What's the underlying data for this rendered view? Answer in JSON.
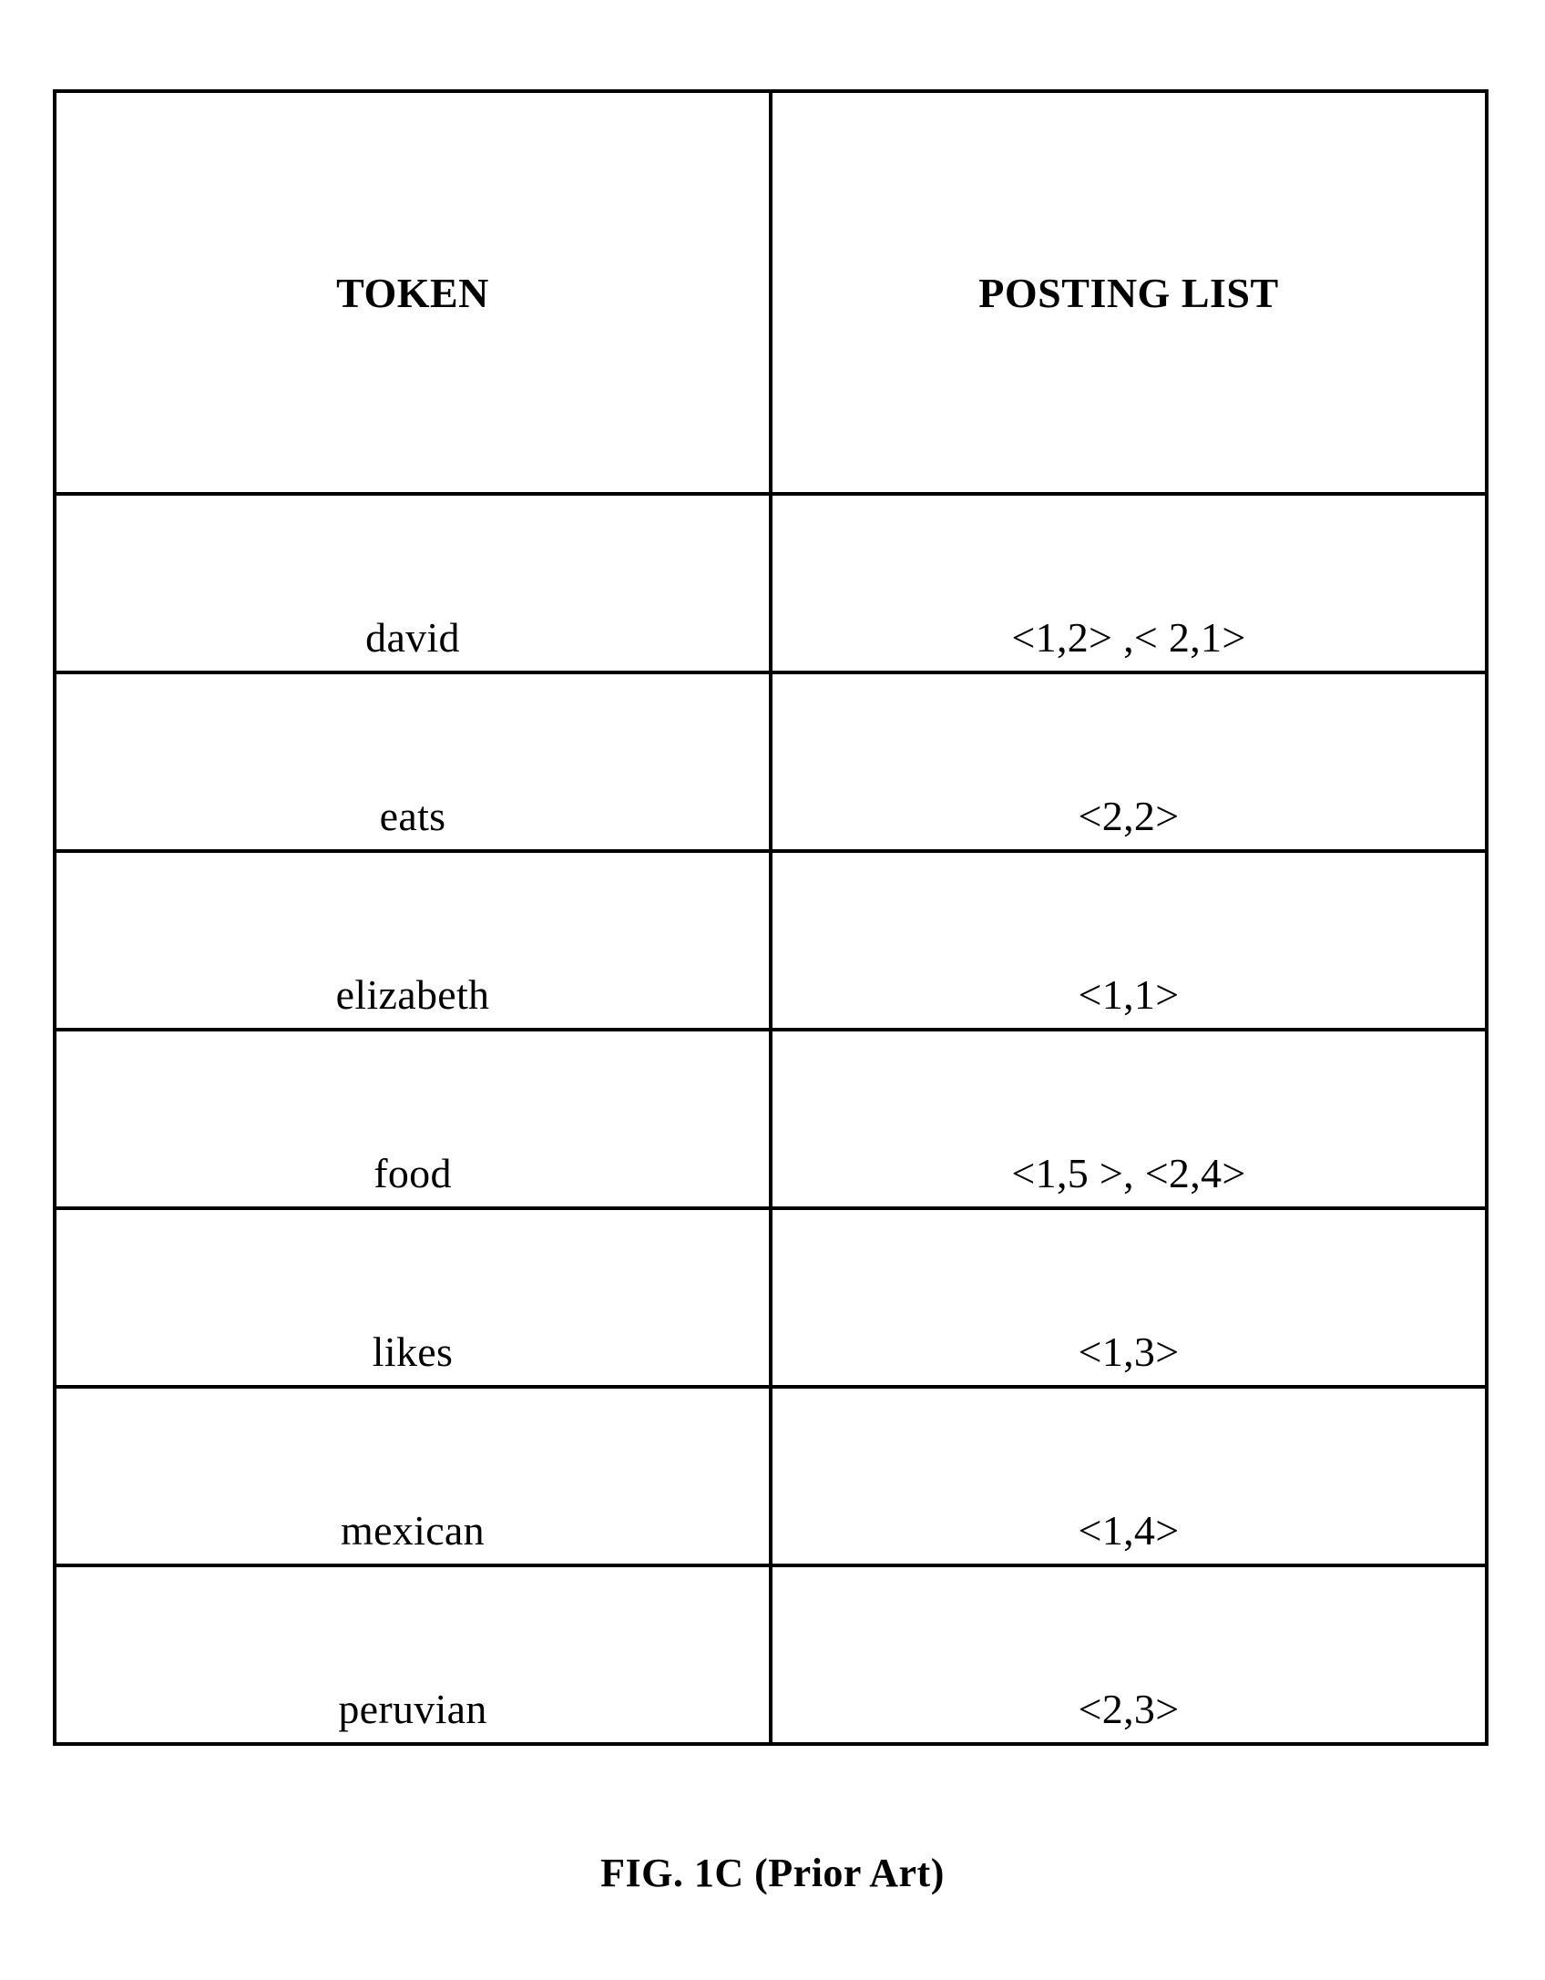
{
  "figure": {
    "caption": "FIG. 1C (Prior Art)",
    "table": {
      "columns": [
        {
          "header": "TOKEN"
        },
        {
          "header": "POSTING LIST"
        }
      ],
      "rows": [
        {
          "token": "david",
          "posting_list": "<1,2> ,< 2,1>"
        },
        {
          "token": "eats",
          "posting_list": "<2,2>"
        },
        {
          "token": "elizabeth",
          "posting_list": "<1,1>"
        },
        {
          "token": "food",
          "posting_list": "<1,5 >, <2,4>"
        },
        {
          "token": "likes",
          "posting_list": "<1,3>"
        },
        {
          "token": "mexican",
          "posting_list": "<1,4>"
        },
        {
          "token": "peruvian",
          "posting_list": "<2,3>"
        }
      ]
    },
    "colors": {
      "ink": "#000000",
      "paper": "#ffffff"
    }
  }
}
